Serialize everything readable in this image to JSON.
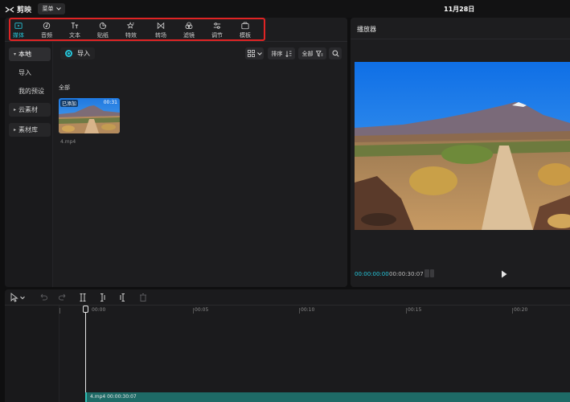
{
  "app": {
    "name": "剪映",
    "menu_label": "菜单",
    "project_title": "11月28日"
  },
  "toolbar": {
    "items": [
      {
        "label": "媒体",
        "icon": "media-icon"
      },
      {
        "label": "音频",
        "icon": "audio-icon"
      },
      {
        "label": "文本",
        "icon": "text-icon"
      },
      {
        "label": "贴纸",
        "icon": "sticker-icon"
      },
      {
        "label": "特效",
        "icon": "effects-icon"
      },
      {
        "label": "转场",
        "icon": "transition-icon"
      },
      {
        "label": "滤镜",
        "icon": "filter-icon"
      },
      {
        "label": "调节",
        "icon": "adjust-icon"
      },
      {
        "label": "模板",
        "icon": "template-icon"
      }
    ],
    "active_index": 0
  },
  "left_nav": {
    "items": [
      {
        "label": "本地"
      },
      {
        "label": "导入"
      },
      {
        "label": "我的预设"
      },
      {
        "label": "云素材"
      },
      {
        "label": "素材库"
      }
    ]
  },
  "media": {
    "import_label": "导入",
    "sort_label": "排序",
    "filter_label": "全部",
    "section_label": "全部",
    "clip": {
      "badge": "已添加",
      "duration": "00:31",
      "filename": "4.mp4"
    }
  },
  "player": {
    "title": "播放器",
    "current_time": "00:00:00:00",
    "total_time": "00:00:30:07"
  },
  "timeline": {
    "ruler_labels": [
      "00:00",
      "00:05",
      "00:10",
      "00:15",
      "00:20"
    ],
    "clip_label": "4.mp4  00:00:30:07"
  },
  "colors": {
    "accent": "#26c6da",
    "highlight_box": "#e02424",
    "clip_track": "#1e6a66"
  }
}
